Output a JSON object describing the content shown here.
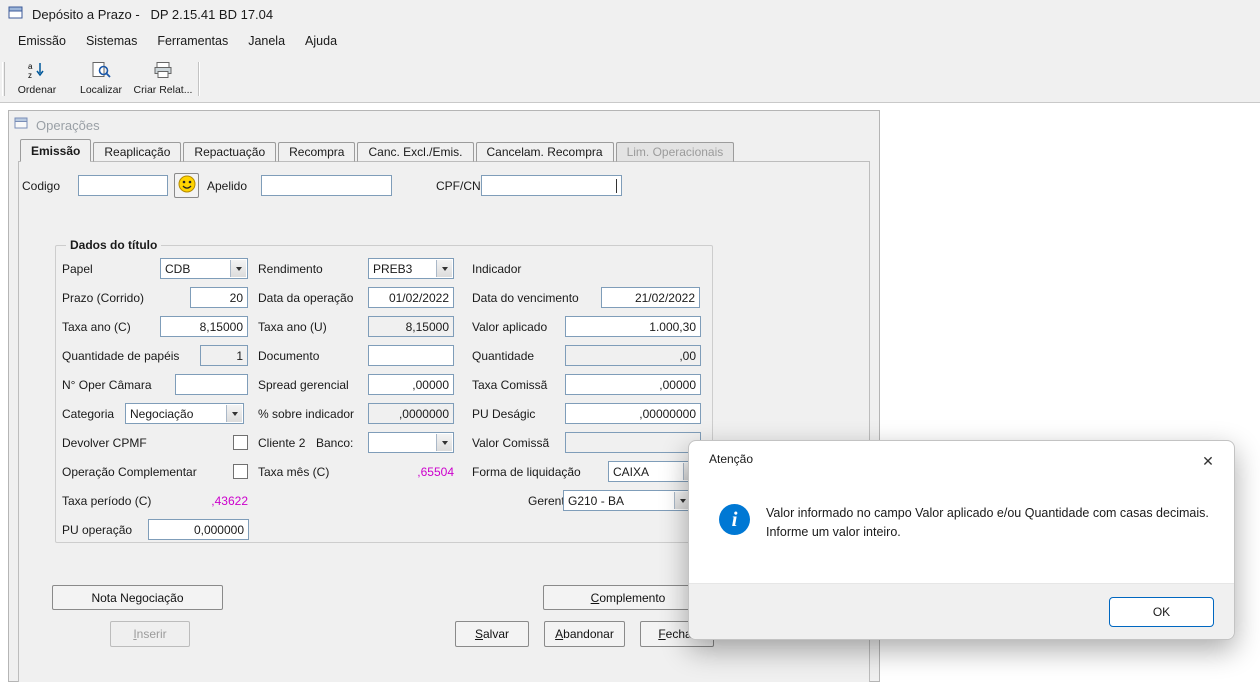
{
  "titlebar": {
    "title": "Depósito a Prazo -   DP 2.15.41 BD 17.04"
  },
  "menu": {
    "items": [
      "Emissão",
      "Sistemas",
      "Ferramentas",
      "Janela",
      "Ajuda"
    ]
  },
  "toolbar": {
    "buttons": [
      {
        "label": "Ordenar"
      },
      {
        "label": "Localizar"
      },
      {
        "label": "Criar Relat..."
      }
    ]
  },
  "operacoes": {
    "title": "Operações",
    "tabs": [
      "Emissão",
      "Reaplicação",
      "Repactuação",
      "Recompra",
      "Canc. Excl./Emis.",
      "Cancelam. Recompra",
      "Lim. Operacionais"
    ]
  },
  "header": {
    "codigo": {
      "label": "Codigo",
      "value": ""
    },
    "apelido": {
      "label": "Apelido",
      "value": ""
    },
    "cpf": {
      "label": "CPF/CNPJ",
      "value": ""
    }
  },
  "dados": {
    "title": "Dados do título",
    "papel": {
      "label": "Papel",
      "value": "CDB"
    },
    "rendimento": {
      "label": "Rendimento",
      "value": "PREB3"
    },
    "indicador": {
      "label": "Indicador"
    },
    "prazo": {
      "label": "Prazo (Corrido)",
      "value": "20"
    },
    "data_operacao": {
      "label": "Data da operação",
      "value": "01/02/2022"
    },
    "data_vencimento": {
      "label": "Data do vencimento",
      "value": "21/02/2022"
    },
    "taxa_ano_c": {
      "label": "Taxa ano (C)",
      "value": "8,15000"
    },
    "taxa_ano_u": {
      "label": "Taxa ano (U)",
      "value": "8,15000"
    },
    "valor_aplicado": {
      "label": "Valor aplicado",
      "value": "1.000,30"
    },
    "qtd_papeis": {
      "label": "Quantidade de papéis",
      "value": "1"
    },
    "documento": {
      "label": "Documento",
      "value": ""
    },
    "quantidade": {
      "label": "Quantidade",
      "value": ",00"
    },
    "oper_camara": {
      "label": "N° Oper Câmara",
      "value": ""
    },
    "spread": {
      "label": "Spread gerencial",
      "value": ",00000"
    },
    "taxa_comissao": {
      "label": "Taxa Comissã",
      "value": ",00000"
    },
    "categoria": {
      "label": "Categoria",
      "value": "Negociação"
    },
    "sobre_indicador": {
      "label": "% sobre indicador",
      "value": ",0000000"
    },
    "pu_desagio": {
      "label": "PU Deságic",
      "value": ",00000000"
    },
    "devolver_cpmf": {
      "label": "Devolver CPMF"
    },
    "cliente2": {
      "label": "Cliente 2"
    },
    "banco": {
      "label": "Banco:",
      "value": ""
    },
    "valor_comissao": {
      "label": "Valor Comissã",
      "value": ""
    },
    "oper_complementar": {
      "label": "Operação Complementar"
    },
    "taxa_mes": {
      "label": "Taxa mês (C)",
      "value": ",65504"
    },
    "forma_liquidacao": {
      "label": "Forma de liquidação",
      "value": "CAIXA"
    },
    "taxa_periodo": {
      "label": "Taxa período (C)",
      "value": ",43622"
    },
    "gerente": {
      "label": "Gerente",
      "value": "G210 - BA"
    },
    "pu_operacao": {
      "label": "PU operação",
      "value": "0,000000"
    }
  },
  "buttons": {
    "nota": "Nota Negociação",
    "inserir": "Inserir",
    "salvar": "Salvar",
    "abandonar": "Abandonar",
    "fechar": "Fechar",
    "complemento": "Complemento"
  },
  "dialog": {
    "title": "Atenção",
    "message": "Valor informado no campo Valor aplicado e/ou Quantidade com casas decimais. Informe um valor inteiro.",
    "ok": "OK",
    "close": "✕"
  },
  "colors": {
    "accent": "#0067c0",
    "info_blue": "#0078d4",
    "magenta": "#cc00cc",
    "field_border": "#7f9db9"
  }
}
